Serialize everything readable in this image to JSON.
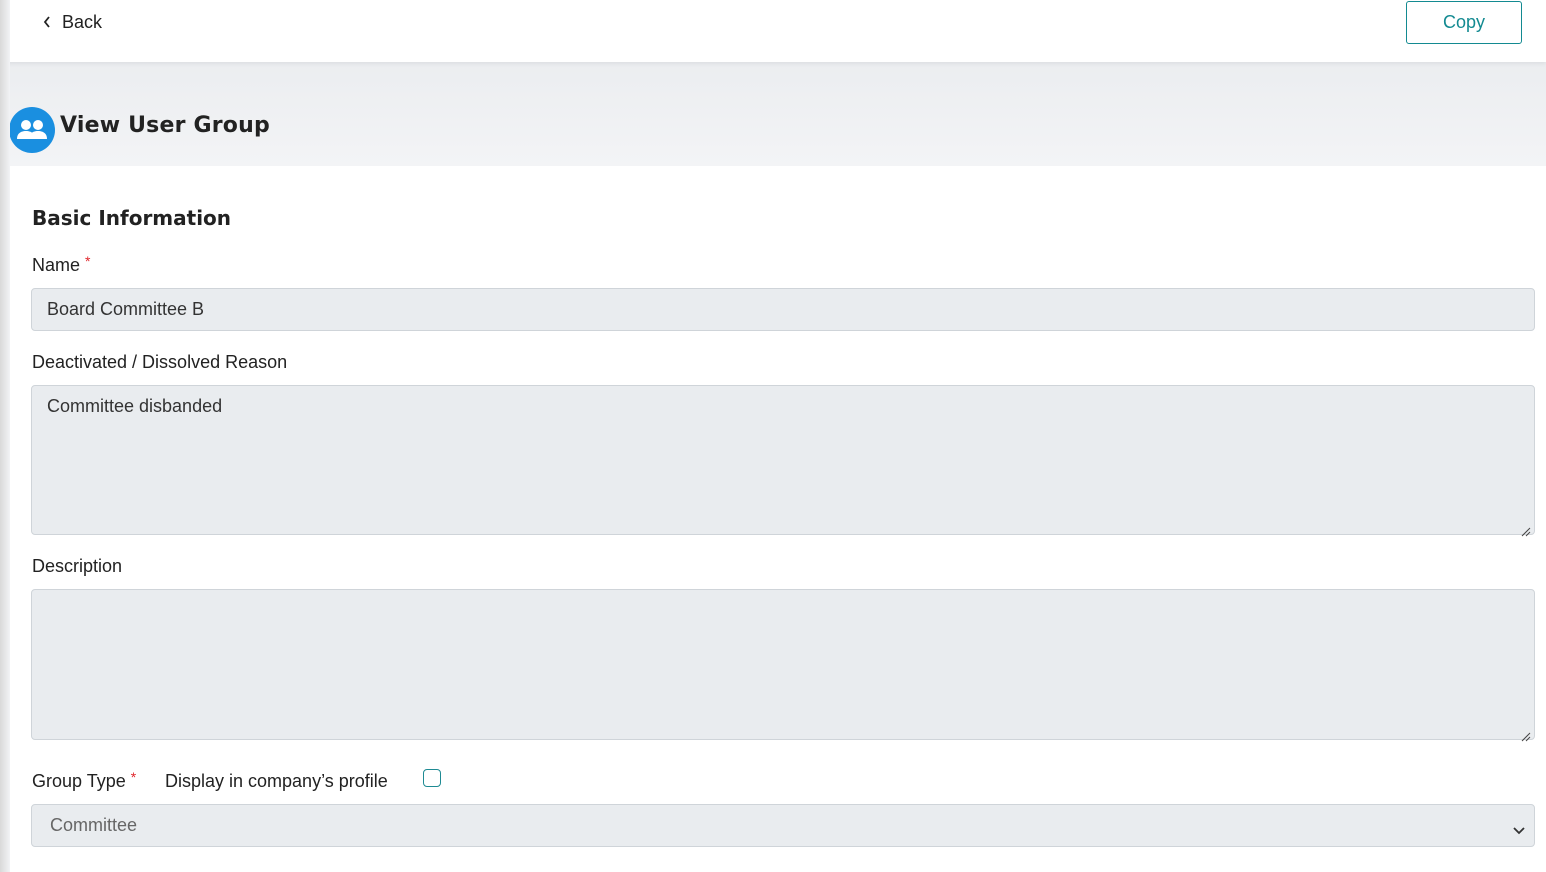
{
  "header": {
    "back_label": "Back",
    "copy_label": "Copy"
  },
  "page": {
    "title": "View User Group",
    "icon": "user-group-icon"
  },
  "form": {
    "section_title": "Basic Information",
    "name": {
      "label": "Name",
      "required_mark": "*",
      "value": "Board Committee B"
    },
    "deactivated_reason": {
      "label": "Deactivated / Dissolved Reason",
      "value": "Committee disbanded"
    },
    "description": {
      "label": "Description",
      "value": ""
    },
    "group_type": {
      "label": "Group Type",
      "required_mark": "*",
      "selected": "Committee"
    },
    "display_in_profile": {
      "label": "Display in company’s profile",
      "checked": false
    }
  },
  "colors": {
    "accent": "#138a91",
    "avatar": "#1a8fe0",
    "required": "#e0262c",
    "field_bg": "#e9ecef"
  }
}
